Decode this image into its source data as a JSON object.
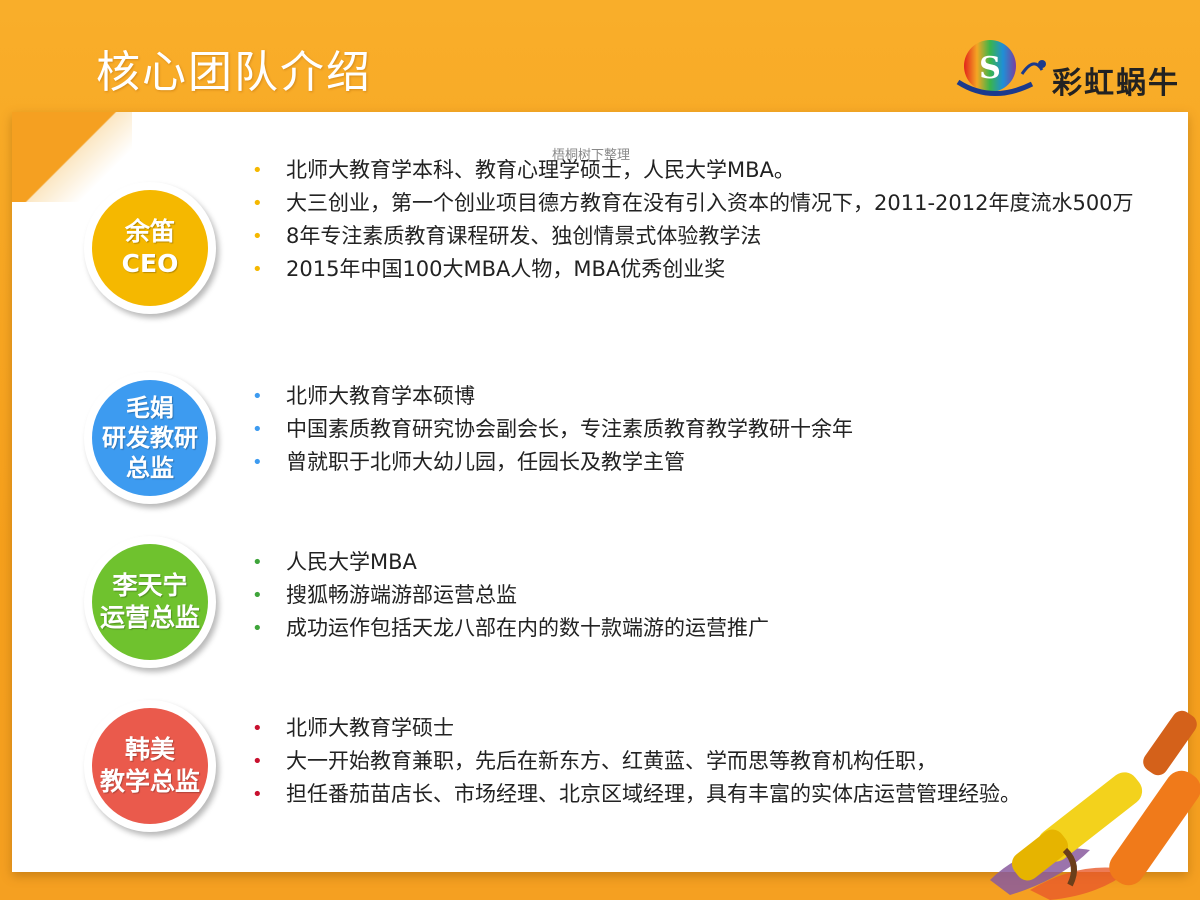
{
  "header": {
    "title": "核心团队介绍"
  },
  "logo": {
    "text": "彩虹蜗牛"
  },
  "watermark": "梧桐树下整理",
  "colors": {
    "orange": "#f6a01c",
    "yellow": "#f5b800",
    "blue": "#3d9bf0",
    "green": "#6fc22e",
    "red": "#ea5a4c"
  },
  "members": [
    {
      "badge_lines": [
        "余笛",
        "CEO"
      ],
      "color": "#f5b800",
      "bullets": [
        "北师大教育学本科、教育心理学硕士，人民大学MBA。",
        "大三创业，第一个创业项目德方教育在没有引入资本的情况下，2011-2012年度流水500万",
        "8年专注素质教育课程研发、独创情景式体验教学法",
        "2015年中国100大MBA人物，MBA优秀创业奖"
      ]
    },
    {
      "badge_lines": [
        "毛娟",
        "研发教研",
        "总监"
      ],
      "color": "#3d9bf0",
      "bullets": [
        "北师大教育学本硕博",
        "中国素质教育研究协会副会长，专注素质教育教学教研十余年",
        "曾就职于北师大幼儿园，任园长及教学主管"
      ]
    },
    {
      "badge_lines": [
        "李天宁",
        "运营总监"
      ],
      "color": "#6fc22e",
      "bullets": [
        "人民大学MBA",
        "搜狐畅游端游部运营总监",
        "成功运作包括天龙八部在内的数十款端游的运营推广"
      ]
    },
    {
      "badge_lines": [
        "韩美",
        "教学总监"
      ],
      "color": "#ea5a4c",
      "bullets": [
        "北师大教育学硕士",
        "大一开始教育兼职，先后在新东方、红黄蓝、学而思等教育机构任职，",
        "担任番茄苗店长、市场经理、北京区域经理，具有丰富的实体店运营管理经验。"
      ]
    }
  ]
}
